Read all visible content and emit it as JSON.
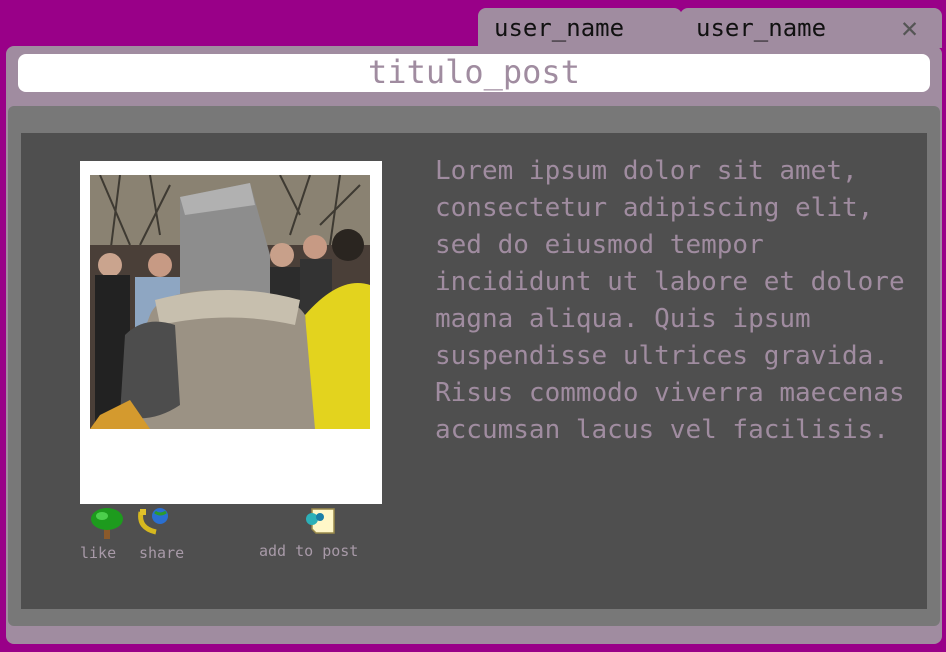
{
  "tabs": [
    {
      "label": "user_name"
    },
    {
      "label": "user_name"
    }
  ],
  "close_glyph": "✕",
  "post": {
    "title": "titulo_post",
    "body": "Lorem ipsum dolor sit amet, consectetur adipiscing elit, sed do eiusmod tempor incididunt ut labore et dolore magna aliqua. Quis ipsum suspendisse ultrices gravida. Risus commodo viverra maecenas accumsan lacus vel facilisis."
  },
  "actions": {
    "like": {
      "label": "like",
      "icon": "tree-icon"
    },
    "share": {
      "label": "share",
      "icon": "phone-globe-icon"
    },
    "add_to_post": {
      "label": "add to post",
      "icon": "note-icon"
    }
  },
  "colors": {
    "background": "#990088",
    "chrome": "#a08ca0",
    "panel_outer": "#787878",
    "panel_inner": "#4f4f4f",
    "text": "#a08ca0"
  }
}
